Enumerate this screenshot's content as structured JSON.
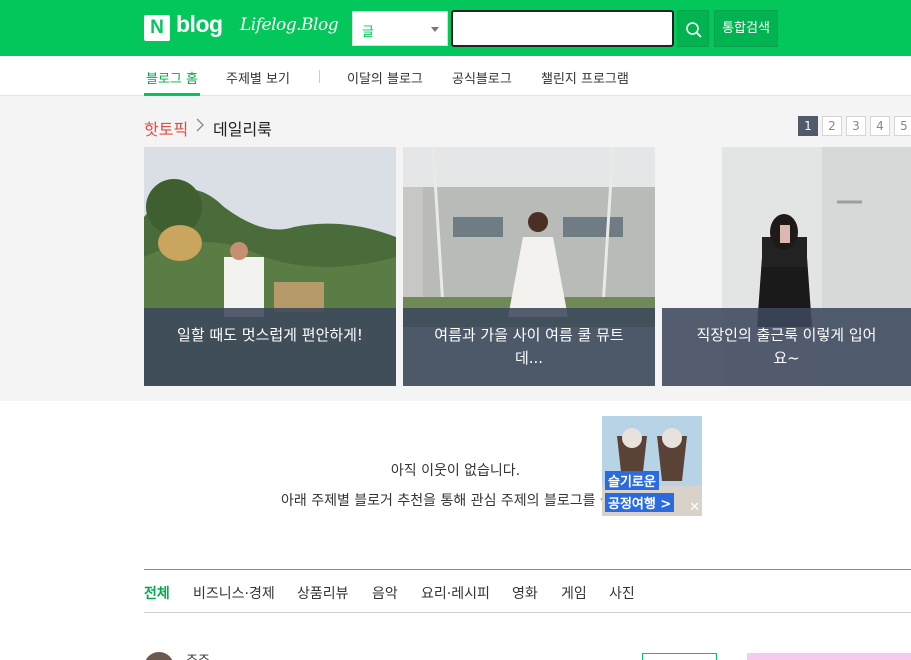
{
  "header": {
    "logo_n": "N",
    "logo_blog": "blog",
    "logo_lifelog": "Lifelog.Blog",
    "search_select": "글",
    "search_value": "",
    "total_search_label": "통합검색",
    "brand_color": "#03c75a"
  },
  "nav": {
    "items": [
      {
        "label": "블로그 홈",
        "active": true
      },
      {
        "label": "주제별 보기",
        "active": false
      },
      {
        "label": "이달의 블로그",
        "active": false
      },
      {
        "label": "공식블로그",
        "active": false
      },
      {
        "label": "챌린지 프로그램",
        "active": false
      }
    ]
  },
  "hot_topic": {
    "label": "핫토픽",
    "topic": "데일리룩",
    "pages": [
      "1",
      "2",
      "3",
      "4",
      "5"
    ],
    "active_page": "1",
    "cards": [
      {
        "caption": "일할 때도 멋스럽게 편안하게!"
      },
      {
        "caption": "여름과 가을 사이 여름 쿨 뮤트 데..."
      },
      {
        "caption": "직장인의 출근룩 이렇게 입어요~"
      }
    ]
  },
  "neighbors": {
    "empty_title": "아직 이웃이 없습니다.",
    "empty_desc": "아래 주제별 블로거 추천을 통해 관심 주제의 블로그를 둘러보세요."
  },
  "ad": {
    "line1": "슬기로운",
    "line2": "공정여행 >",
    "close": "✕"
  },
  "categories": {
    "items": [
      {
        "label": "전체",
        "active": true
      },
      {
        "label": "비즈니스·경제",
        "active": false
      },
      {
        "label": "상품리뷰",
        "active": false
      },
      {
        "label": "음악",
        "active": false
      },
      {
        "label": "요리·레시피",
        "active": false
      },
      {
        "label": "영화",
        "active": false
      },
      {
        "label": "게임",
        "active": false
      },
      {
        "label": "사진",
        "active": false
      }
    ]
  },
  "bottom": {
    "name": "주주"
  }
}
